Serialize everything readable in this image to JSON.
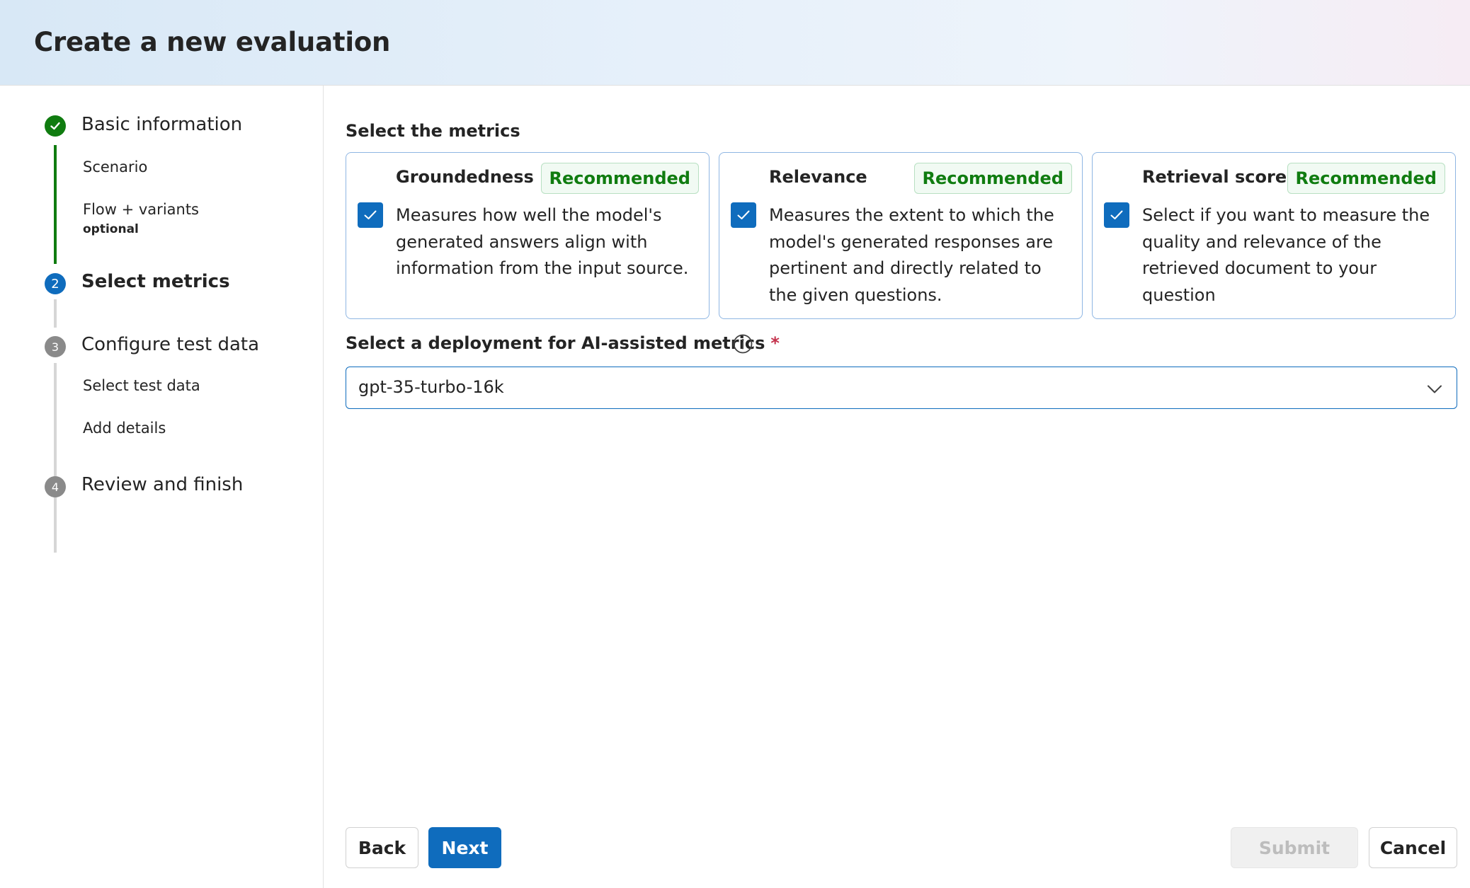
{
  "header": {
    "title": "Create a new evaluation"
  },
  "steps": [
    {
      "number": "",
      "label": "Basic information",
      "status": "completed",
      "substeps": [
        {
          "label": "Scenario"
        },
        {
          "label": "Flow + variants",
          "sublabel": "optional"
        }
      ]
    },
    {
      "number": "2",
      "label": "Select metrics",
      "status": "current",
      "substeps": []
    },
    {
      "number": "3",
      "label": "Configure test data",
      "status": "upcoming",
      "substeps": [
        {
          "label": "Select test data"
        },
        {
          "label": "Add details"
        }
      ]
    },
    {
      "number": "4",
      "label": "Review and finish",
      "status": "upcoming",
      "substeps": []
    }
  ],
  "metrics": {
    "section_title": "Select the metrics",
    "cards": [
      {
        "title": "Groundedness",
        "badge": "Recommended",
        "checked": true,
        "description": "Measures how well the model's generated answers align with information from the input source."
      },
      {
        "title": "Relevance",
        "badge": "Recommended",
        "checked": true,
        "description": "Measures the extent to which the model's generated responses are pertinent and directly related to the given questions."
      },
      {
        "title": "Retrieval score",
        "badge": "Recommended",
        "checked": true,
        "description": "Select if you want to measure the quality and relevance of the retrieved document to your question"
      }
    ]
  },
  "deployment": {
    "label": "Select a deployment for AI-assisted metrics",
    "required_marker": "*",
    "value": "gpt-35-turbo-16k"
  },
  "footer": {
    "back_label": "Back",
    "next_label": "Next",
    "submit_label": "Submit",
    "cancel_label": "Cancel"
  },
  "colors": {
    "accent": "#0f6cbd",
    "success": "#107c10",
    "upcoming": "#8a8a8a"
  }
}
